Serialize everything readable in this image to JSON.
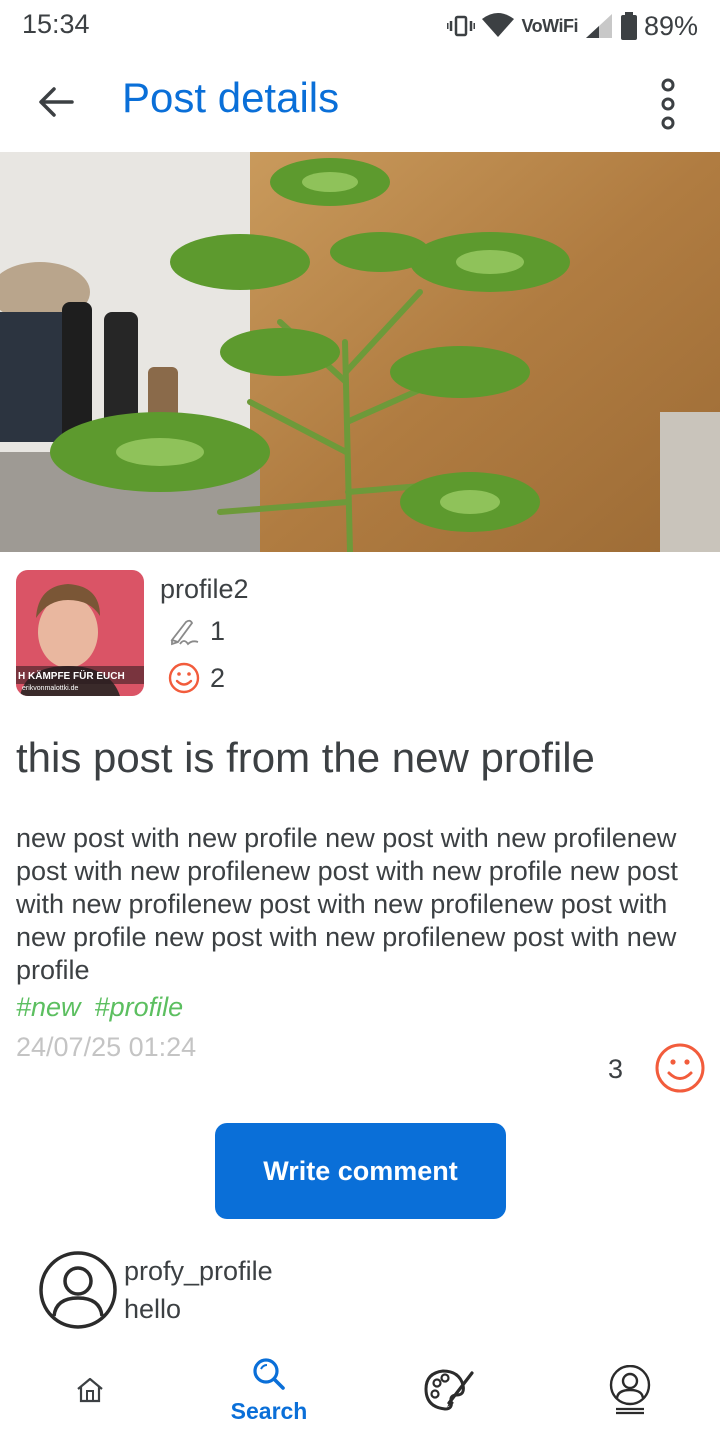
{
  "status_bar": {
    "time": "15:34",
    "network_label": "VoWiFi",
    "battery": "89%",
    "icons": [
      "vibrate-icon",
      "wifi-icon",
      "signal-icon",
      "battery-icon"
    ]
  },
  "app_bar": {
    "title": "Post details",
    "back_icon": "arrow-left-icon",
    "menu_icon": "more-vertical-icon"
  },
  "post": {
    "image_banner_text": "H KÄMPFE FÜR EUCH",
    "image_banner_url": "erikvonmalottki.de",
    "author": "profile2",
    "posts_count": "1",
    "likes_count": "2",
    "title": "this post is from the new profile",
    "body": "new post with new profile new post with new profilenew post with new profilenew post with new profile new post with new profilenew post with new profilenew post with new profile new post with new profilenew post with new profile",
    "tags": [
      "#new",
      "#profile"
    ],
    "date": "24/07/25 01:24",
    "like_count": "3"
  },
  "actions": {
    "write_comment": "Write comment"
  },
  "comments": [
    {
      "author": "profy_profile",
      "text": "hello"
    }
  ],
  "bottom_nav": {
    "home_icon": "home-icon",
    "search_label": "Search",
    "art_icon": "palette-icon",
    "profile_icon": "profile-icon"
  },
  "colors": {
    "accent": "#0a6fd8",
    "tag": "#5cbf60",
    "like": "#f25c3c",
    "date": "#c4c4c4"
  }
}
